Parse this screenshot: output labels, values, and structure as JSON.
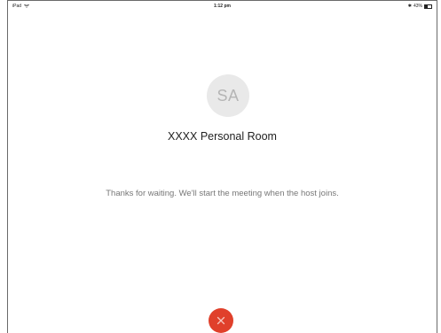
{
  "status_bar": {
    "device": "iPad",
    "time": "1:12 pm",
    "battery": "43%",
    "bluetooth_icon": "bluetooth-icon",
    "wifi_icon": "wifi-icon",
    "battery_icon": "battery-icon"
  },
  "avatar": {
    "initials": "SA",
    "bg_color": "#e9e9e9",
    "text_color": "#b5b5b5"
  },
  "room": {
    "title": "XXXX Personal Room"
  },
  "message": {
    "waiting": "Thanks for waiting. We'll start the meeting when the host joins."
  },
  "leave_button": {
    "icon": "close-icon",
    "color": "#e0402b"
  }
}
